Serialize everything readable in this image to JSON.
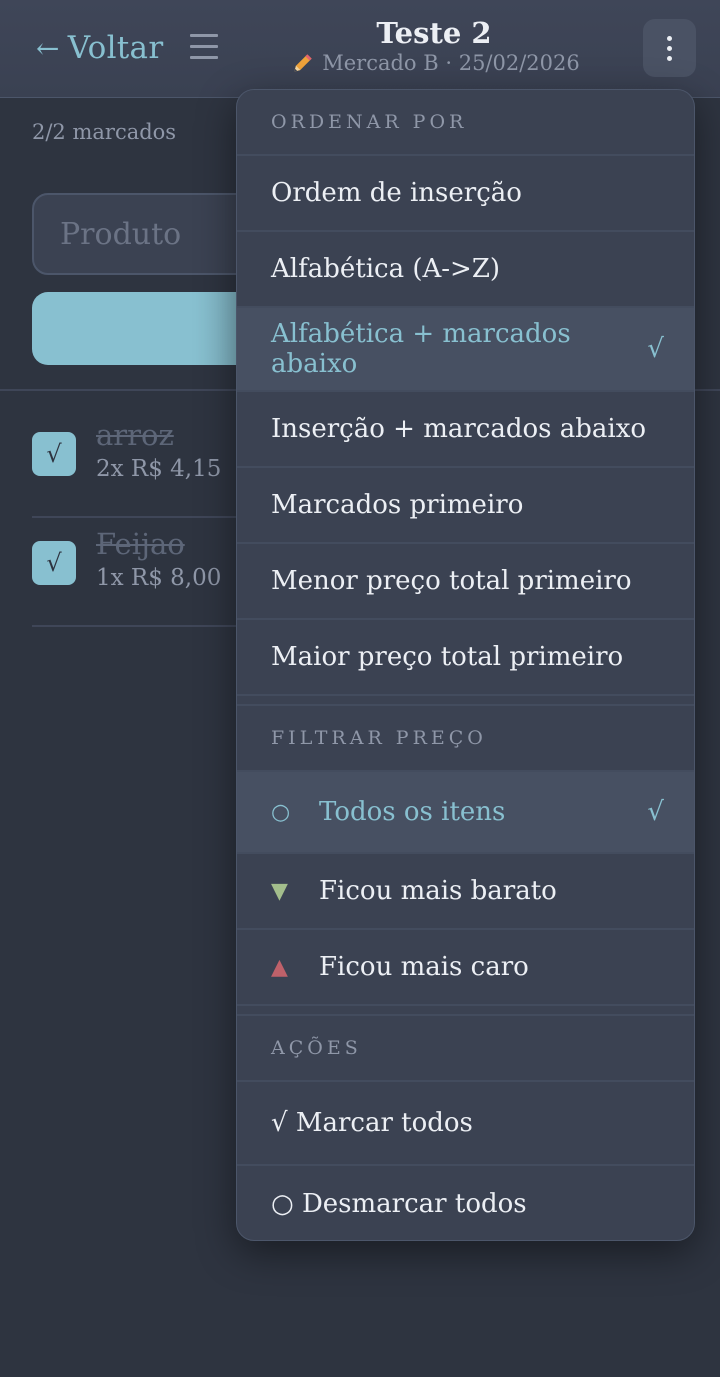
{
  "header": {
    "back_label": "Voltar",
    "back_arrow": "←",
    "title": "Teste 2",
    "subtitle": "Mercado B · 25/02/2026"
  },
  "summary": {
    "checked_count": "2/2 marcados"
  },
  "form": {
    "product_placeholder": "Produto"
  },
  "items": [
    {
      "name": "arroz",
      "meta": "2x R$ 4,15",
      "checked": true,
      "check_glyph": "√"
    },
    {
      "name": "Feijao",
      "meta": "1x R$ 8,00",
      "checked": true,
      "check_glyph": "√"
    }
  ],
  "menu": {
    "sort_header": "ORDENAR POR",
    "sort_options": [
      {
        "label": "Ordem de inserção",
        "selected": false
      },
      {
        "label": "Alfabética (A->Z)",
        "selected": false
      },
      {
        "label": "Alfabética + marcados abaixo",
        "selected": true
      },
      {
        "label": "Inserção + marcados abaixo",
        "selected": false
      },
      {
        "label": "Marcados primeiro",
        "selected": false
      },
      {
        "label": "Menor preço total primeiro",
        "selected": false
      },
      {
        "label": "Maior preço total primeiro",
        "selected": false
      }
    ],
    "selected_mark": "√",
    "filter_header": "FILTRAR PREÇO",
    "filter_options": [
      {
        "icon": "circle-icon",
        "glyph": "○",
        "label": "Todos os itens",
        "selected": true
      },
      {
        "icon": "triangle-down-icon",
        "glyph": "▼",
        "label": "Ficou mais barato",
        "selected": false,
        "color": "#a3be8c"
      },
      {
        "icon": "triangle-up-icon",
        "glyph": "▲",
        "label": "Ficou mais caro",
        "selected": false,
        "color": "#bf616a"
      }
    ],
    "actions_header": "AÇÕES",
    "actions": [
      {
        "label": "√ Marcar todos"
      },
      {
        "label": "○ Desmarcar todos"
      }
    ]
  },
  "colors": {
    "accent": "#88c0d0",
    "background": "#2e3440",
    "menu_background": "#3b4252"
  }
}
